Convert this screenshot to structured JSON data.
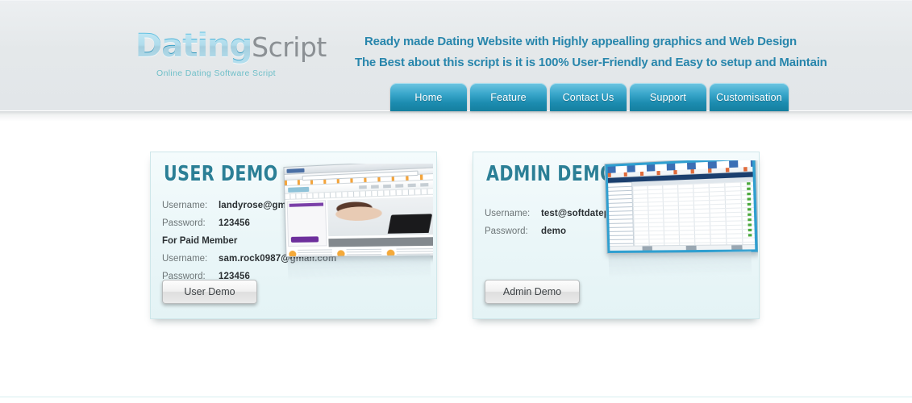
{
  "header": {
    "logo": {
      "part_blue": "Dating",
      "part_gray": "Script",
      "subtitle": "Online Dating Software Script"
    },
    "tagline_line1": "Ready made Dating Website with Highly appealling graphics and Web Design",
    "tagline_line2": "The Best about this script is it is 100% User-Friendly and Easy to setup and Maintain",
    "nav": [
      {
        "label": "Home"
      },
      {
        "label": "Feature"
      },
      {
        "label": "Contact Us"
      },
      {
        "label": "Support"
      },
      {
        "label": "Customisation"
      }
    ]
  },
  "panels": {
    "user": {
      "title": "USER DEMO",
      "rows": [
        {
          "label": "Username:",
          "value": "landyrose@gmail.com"
        },
        {
          "label": "Password:",
          "value": "123456"
        }
      ],
      "paid_heading": "For Paid Member",
      "paid_rows": [
        {
          "label": "Username:",
          "value": "sam.rock0987@gmail.com"
        },
        {
          "label": "Password:",
          "value": "123456"
        }
      ],
      "button": "User Demo"
    },
    "admin": {
      "title": "ADMIN DEMO",
      "rows": [
        {
          "label": "Username:",
          "value": "test@softdatepro.com"
        },
        {
          "label": "Password:",
          "value": "demo"
        }
      ],
      "button": "Admin Demo"
    }
  },
  "colors": {
    "accent_teal": "#2b7f96",
    "tab_blue": "#1c8cb0",
    "tagline_blue": "#2886ac",
    "header_bg": "#e4e8ea",
    "panel_bg": "#eaf6f8",
    "panel_border": "#cfe7ea"
  }
}
